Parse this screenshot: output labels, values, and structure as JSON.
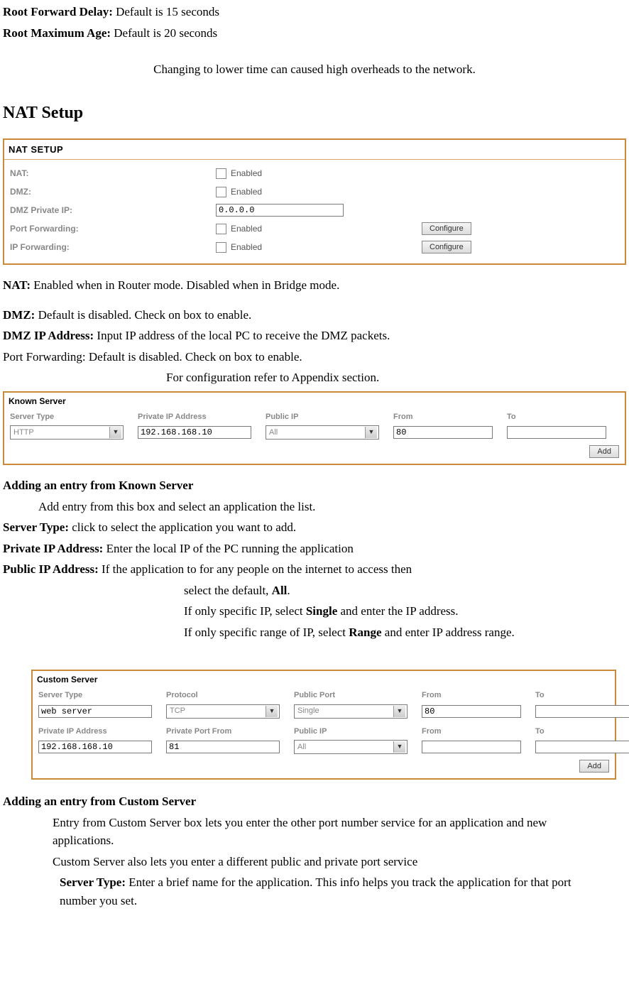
{
  "intro": {
    "root_forward_delay_label": "Root Forward Delay:",
    "root_forward_delay_text": " Default is 15 seconds",
    "root_max_age_label": "Root Maximum Age:",
    "root_max_age_text": " Default is 20 seconds",
    "note": "Changing to lower time can caused high overheads to the network."
  },
  "nat_section_title": "NAT Setup",
  "nat_panel": {
    "title": "NAT SETUP",
    "rows": {
      "nat": {
        "label": "NAT:",
        "text": "Enabled"
      },
      "dmz": {
        "label": "DMZ:",
        "text": "Enabled"
      },
      "dmz_ip": {
        "label": "DMZ Private IP:",
        "value": "0.0.0.0"
      },
      "pf": {
        "label": "Port Forwarding:",
        "text": "Enabled",
        "btn": "Configure"
      },
      "ipf": {
        "label": "IP Forwarding:",
        "text": "Enabled",
        "btn": "Configure"
      }
    }
  },
  "nat_text": {
    "nat_label": "NAT:",
    "nat_desc": " Enabled when in Router mode. Disabled when in Bridge mode.",
    "dmz_label": "DMZ:",
    "dmz_desc": " Default is disabled. Check on box to enable.",
    "dmzip_label": "DMZ IP Address:",
    "dmzip_desc": " Input IP address of the local PC to receive the DMZ packets.",
    "pf_line": "Port Forwarding: Default is disabled. Check on box to enable.",
    "pf_note": "For configuration refer to Appendix section."
  },
  "known_server": {
    "title": "Known Server",
    "headers": {
      "server_type": "Server Type",
      "private_ip": "Private IP Address",
      "public_ip": "Public IP",
      "from": "From",
      "to": "To"
    },
    "row": {
      "server_type": "HTTP",
      "private_ip": "192.168.168.10",
      "public_ip": "All",
      "from": "80",
      "to": ""
    },
    "add_btn": "Add"
  },
  "known_server_text": {
    "heading": "Adding an entry from Known Server",
    "line1": "Add entry from this box and select an application the list.",
    "st_label": "Server Type:",
    "st_desc": " click to select the application you want to add.",
    "pip_label": "Private IP Address:",
    "pip_desc": " Enter the local IP of the PC running the application",
    "pub_label": "Public IP Address:",
    "pub_desc": " If the application to for any people on the internet to access then",
    "pub_line2a": "select the default, ",
    "pub_line2b": "All",
    "pub_line2c": ".",
    "pub_line3a": "If only specific IP, select ",
    "pub_line3b": "Single",
    "pub_line3c": " and enter the IP address.",
    "pub_line4a": "If only specific range of IP, select ",
    "pub_line4b": "Range",
    "pub_line4c": " and enter IP address range."
  },
  "custom_server": {
    "title": "Custom Server",
    "headers": {
      "server_type": "Server Type",
      "protocol": "Protocol",
      "public_port": "Public Port",
      "from": "From",
      "to": "To",
      "private_ip": "Private IP Address",
      "private_port_from": "Private Port From",
      "public_ip": "Public IP",
      "from2": "From",
      "to2": "To"
    },
    "row1": {
      "server_type": "web server",
      "protocol": "TCP",
      "public_port": "Single",
      "from": "80",
      "to": ""
    },
    "row2": {
      "private_ip": "192.168.168.10",
      "private_port_from": "81",
      "public_ip": "All",
      "from": "",
      "to": ""
    },
    "add_btn": "Add"
  },
  "custom_server_text": {
    "heading": "Adding an entry from Custom Server",
    "p1": "Entry from Custom Server box lets you enter the other port number service for an application and new applications.",
    "p2": "Custom Server also lets you enter a different public and private port service",
    "st_label": "Server Type:",
    "st_desc": " Enter a brief name for the application. This info helps you track the application for that port number you set."
  }
}
